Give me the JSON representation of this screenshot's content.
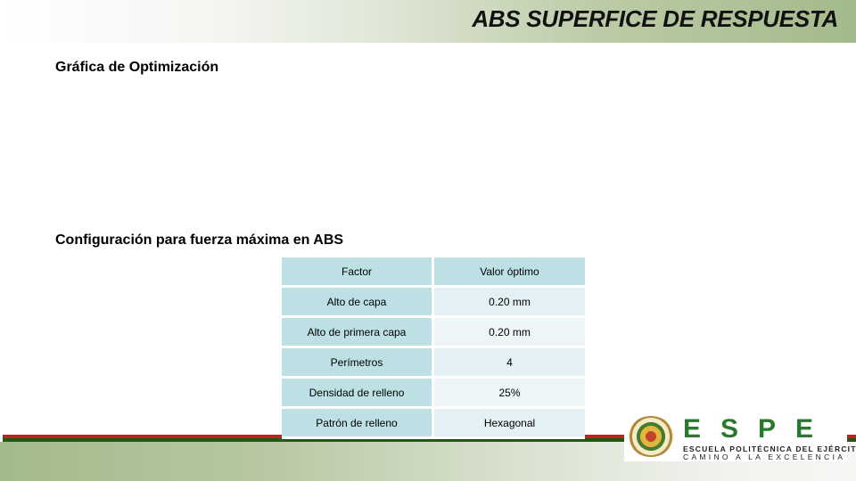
{
  "slide": {
    "title": "ABS SUPERFICE DE RESPUESTA"
  },
  "sections": {
    "optimization_heading": "Gráfica de Optimización",
    "config_heading": "Configuración para fuerza máxima en ABS"
  },
  "table": {
    "headers": [
      "Factor",
      "Valor óptimo"
    ],
    "rows": [
      {
        "factor": "Alto de capa",
        "value": "0.20 mm"
      },
      {
        "factor": "Alto de primera capa",
        "value": "0.20 mm"
      },
      {
        "factor": "Perímetros",
        "value": "4"
      },
      {
        "factor": "Densidad de relleno",
        "value": "25%"
      },
      {
        "factor": "Patrón de relleno",
        "value": "Hexagonal"
      }
    ]
  },
  "logo": {
    "letters": "ESPE",
    "line1": "ESCUELA POLITÉCNICA DEL EJÉRCITO",
    "line2": "CAMINO A LA EXCELENCIA",
    "icon": "university-crest-icon"
  },
  "colors": {
    "header_green": "#a3ba8b",
    "stripe_red": "#c8201e",
    "stripe_green": "#1f5a14",
    "table_header": "#bde0e5",
    "table_value": "#e4f1f4",
    "logo_green": "#2a7a2e"
  }
}
